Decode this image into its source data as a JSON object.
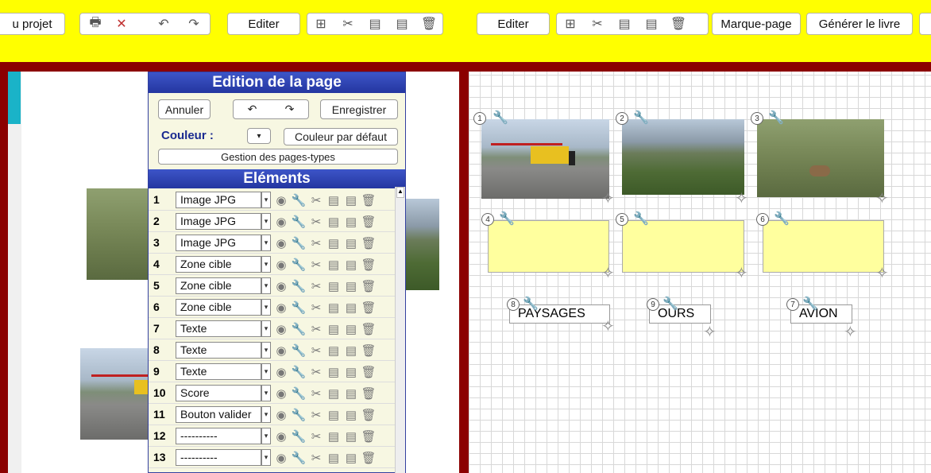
{
  "toolbar": {
    "project_label": "u projet",
    "edit1": "Editer",
    "edit2": "Editer",
    "bookmark": "Marque-page",
    "generate": "Générer le livre"
  },
  "panel": {
    "title": "Edition de la page",
    "cancel": "Annuler",
    "save": "Enregistrer",
    "color_label": "Couleur :",
    "default_color": "Couleur par défaut",
    "page_types": "Gestion des pages-types",
    "elements_title": "Eléments",
    "rows": [
      {
        "num": "1",
        "type": "Image JPG"
      },
      {
        "num": "2",
        "type": "Image JPG"
      },
      {
        "num": "3",
        "type": "Image JPG"
      },
      {
        "num": "4",
        "type": "Zone cible"
      },
      {
        "num": "5",
        "type": "Zone cible"
      },
      {
        "num": "6",
        "type": "Zone cible"
      },
      {
        "num": "7",
        "type": "Texte"
      },
      {
        "num": "8",
        "type": "Texte"
      },
      {
        "num": "9",
        "type": "Texte"
      },
      {
        "num": "10",
        "type": "Score"
      },
      {
        "num": "11",
        "type": "Bouton valider"
      },
      {
        "num": "12",
        "type": "----------"
      },
      {
        "num": "13",
        "type": "----------"
      }
    ]
  },
  "page": {
    "badges": [
      "1",
      "2",
      "3",
      "4",
      "5",
      "6",
      "8",
      "9",
      "7"
    ],
    "labels": {
      "paysages": "PAYSAGES",
      "ours": "OURS",
      "avion": "AVION"
    }
  },
  "colors": {
    "toolbar_bg": "#ffff00",
    "frame": "#8b0000",
    "panel_header": "#2a3db0",
    "target_zone": "#ffff9e"
  }
}
